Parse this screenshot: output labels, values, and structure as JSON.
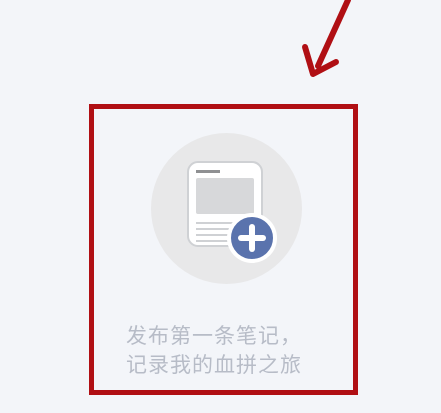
{
  "empty_state": {
    "hint_line_1": "发布第一条笔记，",
    "hint_line_2": "记录我的血拼之旅"
  },
  "icons": {
    "illustration": "document-icon",
    "action": "plus-circle-icon",
    "annotation": "red-arrow-icon"
  },
  "colors": {
    "background": "#f3f5f9",
    "highlight": "#b00f14",
    "circle": "#e8e8e9",
    "plus_button": "#5a73ad",
    "hint_text": "#b7bcc7"
  }
}
